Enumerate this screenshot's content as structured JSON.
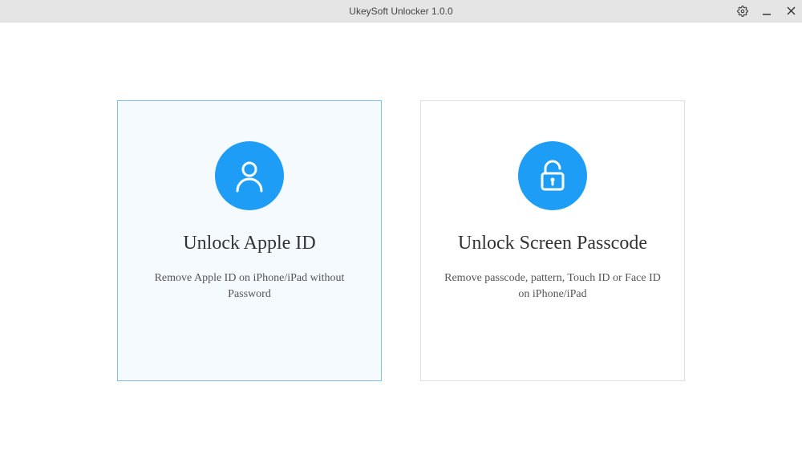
{
  "titlebar": {
    "title": "UkeySoft Unlocker 1.0.0"
  },
  "cards": {
    "apple_id": {
      "title": "Unlock Apple ID",
      "desc": "Remove Apple ID on iPhone/iPad without Password"
    },
    "screen_passcode": {
      "title": "Unlock Screen Passcode",
      "desc": "Remove passcode, pattern, Touch ID or Face ID on iPhone/iPad"
    }
  }
}
